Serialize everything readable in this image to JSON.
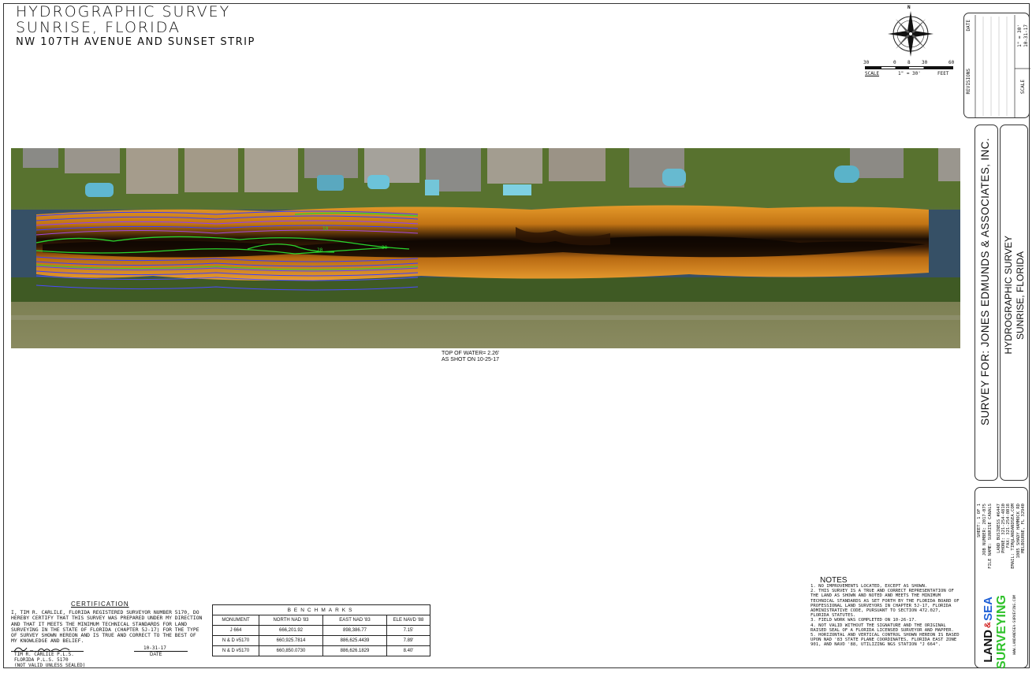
{
  "header": {
    "title_line1": "HYDROGRAPHIC SURVEY",
    "title_line2": "SUNRISE, FLORIDA",
    "subtitle": "NW 107TH AVENUE AND SUNSET STRIP"
  },
  "north_arrow": {
    "label": "N",
    "icon": "compass-rose-icon"
  },
  "scale_bar": {
    "ticks": [
      "30",
      "0",
      "8",
      "30",
      "60"
    ],
    "label": "SCALE",
    "ratio": "1\" = 30'",
    "unit": "FEET"
  },
  "water_note": {
    "line1": "TOP OF WATER= 2.26'",
    "line2": "AS SHOT ON 10-25-17"
  },
  "contour_labels": [
    "10",
    "20",
    "30"
  ],
  "certification": {
    "title": "CERTIFICATION",
    "body": "I, TIM R. CARLILE, FLORIDA REGISTERED SURVEYOR NUMBER 5170, DO HEREBY CERTIFY THAT THIS SURVEY WAS PREPARED UNDER MY DIRECTION AND THAT IT MEETS THE MINIMUM TECHNICAL STANDARDS FOR LAND SURVEYING IN THE STATE OF FLORIDA (CHAPTER 5J-17) FOR THE TYPE OF SURVEY SHOWN HEREON AND IS TRUE AND CORRECT TO THE BEST OF MY KNOWLEDGE AND BELIEF.",
    "date_value": "10-31-17",
    "date_label": "DATE",
    "surveyor_name": "TIM R. CARLILE P.L.S.",
    "license": "FLORIDA P.L.S. 5170",
    "disclaimer": "(NOT VALID UNLESS SEALED)"
  },
  "benchmarks": {
    "caption": "BENCHMARKS",
    "headers": [
      "MONUMENT",
      "NORTH NAD '83",
      "EAST NAD '83",
      "ELE NAVD '88"
    ],
    "rows": [
      [
        "J 664",
        "666,201.92",
        "898,386.77",
        "7.15'"
      ],
      [
        "N & D #5170",
        "660,925.7814",
        "886,625.4439",
        "7.89'"
      ],
      [
        "N & D #5170",
        "660,850.0730",
        "886,626.1829",
        "8.40'"
      ]
    ]
  },
  "notes": {
    "title": "NOTES",
    "items": [
      "1.  NO IMPROVEMENTS LOCATED, EXCEPT AS SHOWN.",
      "2.  THIS SURVEY IS A TRUE AND CORRECT REPRESENTATION OF THE LAND AS SHOWN AND NOTED AND MEETS THE MINIMUM TECHNICAL STANDARDS AS SET FORTH BY THE FLORIDA BOARD OF PROFESSIONAL LAND SURVEYORS IN CHAPTER 5J-17, FLORIDA ADMINISTRATIVE CODE, PURSUANT TO SECTION 472.027, FLORIDA STATUTES.",
      "3.  FIELD WORK WAS COMPLETED ON 10-26-17.",
      "4.  NOT VALID WITHOUT THE SIGNATURE AND THE ORIGINAL RAISED SEAL OF A FLORIDA LICENSED SURVEYOR AND MAPPER.",
      "5.  HORIZONTAL AND VERTICAL CONTROL SHOWN HEREON IS BASED UPON NAD '83 STATE PLANE COORDINATES, FLORIDA EAST ZONE 901, AND NAVD '88, UTILIZING NGS STATION \"J 664\"."
    ]
  },
  "title_block": {
    "revisions_label": "REVISIONS",
    "date_label": "DATE",
    "scale_label": "SCALE",
    "scale_value": "1\" = 30'",
    "scale_value2": "10-31-17",
    "client": "SURVEY FOR: JONES EDMUNDS & ASSOCIATES, INC.",
    "project_line1": "HYDROGRAPHIC SURVEY",
    "project_line2": "SUNRISE, FLORIDA",
    "sheet": "SHEET:  1 OF 1",
    "job_number": "JOB NUMBER:  2017-075",
    "file_name": "FILE NAME:  SUNRISE CANALS",
    "business": "LAND BUSINESS #6447",
    "phone": "PHONE: 321-254-4810",
    "fax": "FAX: 321-254-8018",
    "email": "EMAIL: TIM@LANDANDSEA.COM",
    "address1": "1085 SHADY HAMMOCK RD",
    "address2": "MELBOURNE, FL 32940",
    "website": "WWW.LANDANDSEA-SURVEYING.COM",
    "logo_land": "LAND",
    "logo_and": "&",
    "logo_sea": "SEA",
    "logo_surveying": "SURVEYING"
  }
}
